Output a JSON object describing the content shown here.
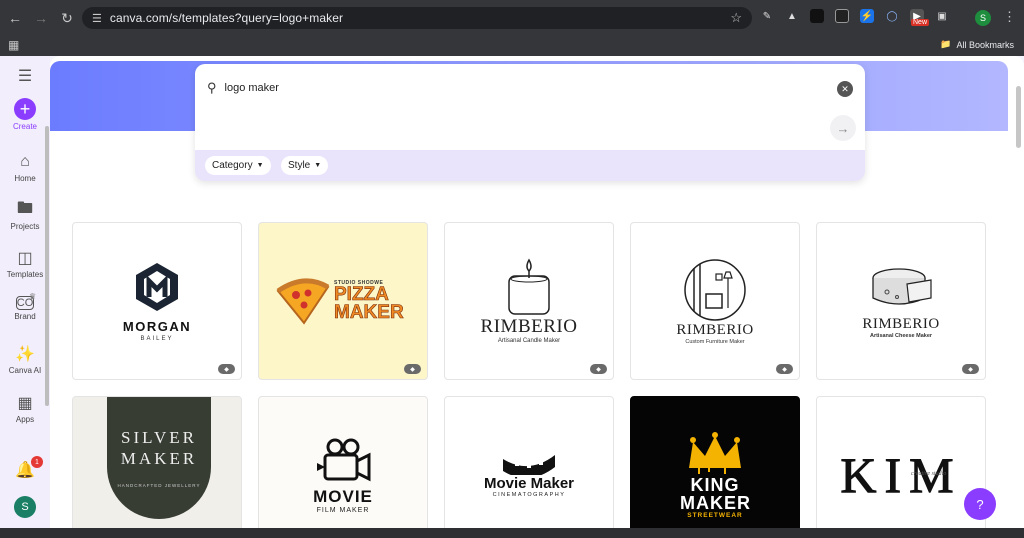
{
  "browser": {
    "url": "canva.com/s/templates?query=logo+maker",
    "all_bookmarks": "All Bookmarks",
    "profile_initial": "S",
    "new_badge": "New"
  },
  "sidebar": {
    "items": [
      {
        "label": "Create",
        "icon": "plus-icon"
      },
      {
        "label": "Home",
        "icon": "home-icon"
      },
      {
        "label": "Projects",
        "icon": "folder-icon"
      },
      {
        "label": "Templates",
        "icon": "templates-icon"
      },
      {
        "label": "Brand",
        "icon": "brand-icon"
      },
      {
        "label": "Canva AI",
        "icon": "sparkle-icon"
      },
      {
        "label": "Apps",
        "icon": "apps-icon"
      }
    ],
    "notifications_count": "1",
    "avatar_initial": "S"
  },
  "search": {
    "query": "logo maker",
    "filters": [
      {
        "label": "Category"
      },
      {
        "label": "Style"
      }
    ]
  },
  "templates": [
    {
      "title": "MORGAN",
      "subtitle": "BAILEY"
    },
    {
      "title": "PIZZA MAKER",
      "subtitle": "STUDIO SHODWE"
    },
    {
      "title": "RIMBERIO",
      "subtitle": "Artisanal Candle Maker"
    },
    {
      "title": "RIMBERIO",
      "subtitle": "Custom Furniture Maker"
    },
    {
      "title": "RIMBERIO",
      "subtitle": "Artisanal Cheese Maker"
    },
    {
      "title": "SILVER MAKER",
      "subtitle": "HANDCRAFTED JEWELLERY"
    },
    {
      "title": "MOVIE",
      "subtitle": "FILM MAKER"
    },
    {
      "title": "Movie Maker",
      "subtitle": "CINEMATOGRAPHY"
    },
    {
      "title": "KING MAKER",
      "subtitle": "STREETWEAR"
    },
    {
      "title": "KIM",
      "subtitle": "creative studio"
    }
  ],
  "help_label": "?"
}
